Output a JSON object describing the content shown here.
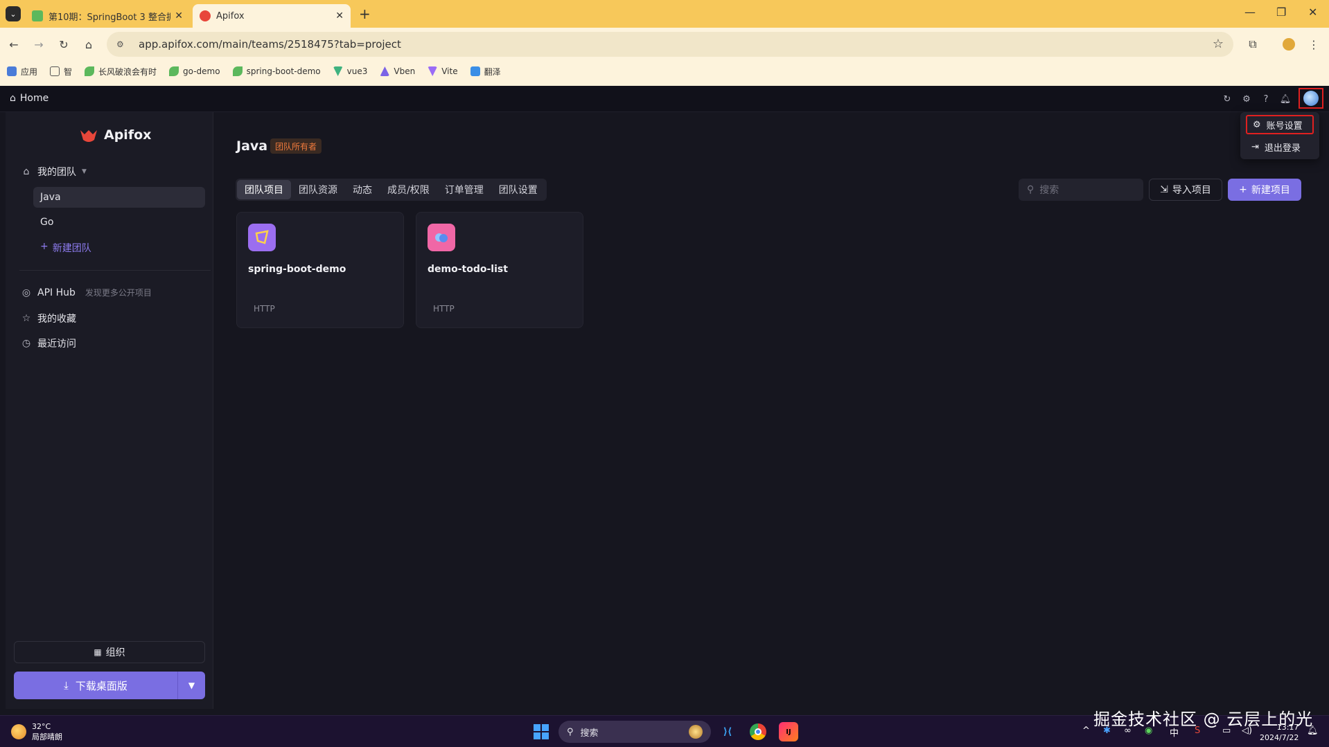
{
  "browser": {
    "tabs": [
      {
        "title": "第10期：SpringBoot 3 整合据",
        "favicon_color": "#5cb85c"
      },
      {
        "title": "Apifox",
        "favicon_color": "#e8463a"
      }
    ],
    "url": "app.apifox.com/main/teams/2518475?tab=project",
    "bookmarks": [
      {
        "label": "应用",
        "color": "#4a7bd8"
      },
      {
        "label": "智",
        "color": "#555555"
      },
      {
        "label": "长风破浪会有时",
        "color": "#5cb85c"
      },
      {
        "label": "go-demo",
        "color": "#5cb85c"
      },
      {
        "label": "spring-boot-demo",
        "color": "#5cb85c"
      },
      {
        "label": "vue3",
        "color": "#3fb27f"
      },
      {
        "label": "Vben",
        "color": "#7b63e6"
      },
      {
        "label": "Vite",
        "color": "#9a6cf6"
      },
      {
        "label": "翻泽",
        "color": "#3a8ee6"
      }
    ]
  },
  "app": {
    "home_label": "Home",
    "brand": "Apifox",
    "sidebar": {
      "my_team": "我的团队",
      "teams": [
        {
          "name": "Java",
          "active": true
        },
        {
          "name": "Go",
          "active": false
        }
      ],
      "new_team": "新建团队",
      "api_hub": "API Hub",
      "api_hub_sub": "发现更多公开项目",
      "favorites": "我的收藏",
      "recent": "最近访问",
      "org_label": "组织",
      "download_label": "下载桌面版"
    },
    "main": {
      "team_name": "Java",
      "owner_badge": "团队所有者",
      "tabs": [
        "团队项目",
        "团队资源",
        "动态",
        "成员/权限",
        "订单管理",
        "团队设置"
      ],
      "active_tab": 0,
      "search_placeholder": "搜索",
      "import_label": "导入项目",
      "new_project_label": "新建项目",
      "projects": [
        {
          "name": "spring-boot-demo",
          "type": "HTTP",
          "icon_color": "#9b6ef0"
        },
        {
          "name": "demo-todo-list",
          "type": "HTTP",
          "icon_color": "#f067a6"
        }
      ]
    },
    "account_menu": {
      "items": [
        "账号设置",
        "退出登录"
      ],
      "highlighted": 0
    },
    "accent_color": "#7a6ee2"
  },
  "taskbar": {
    "temperature": "32°C",
    "weather": "局部晴朗",
    "search_label": "搜索",
    "ime": "中",
    "time": "13:17",
    "date": "2024/7/22"
  },
  "watermark": "掘金技术社区 @ 云层上的光"
}
